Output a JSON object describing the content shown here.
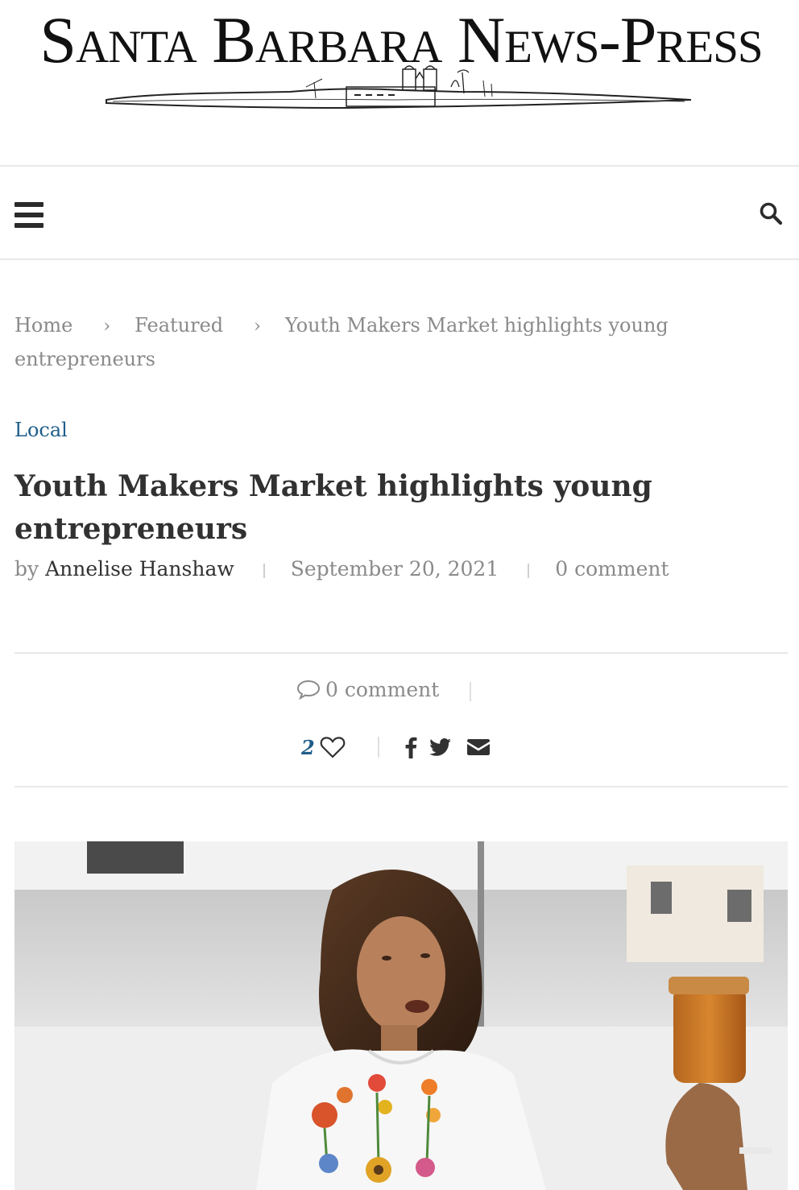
{
  "masthead": {
    "title": "Santa Barbara News-Press"
  },
  "nav": {
    "menu_icon": "hamburger-icon",
    "search_icon": "search-icon"
  },
  "breadcrumb": {
    "home": "Home",
    "featured": "Featured",
    "current": "Youth Makers Market highlights young entrepreneurs",
    "separator": "›"
  },
  "article": {
    "category": "Local",
    "title": "Youth Makers Market highlights young entrepreneurs",
    "by_label": "by",
    "author": "Annelise Hanshaw",
    "date": "September 20, 2021",
    "comments": "0 comment"
  },
  "share": {
    "comment_label": "0 comment",
    "like_count": "2",
    "icons": [
      "comment-icon",
      "heart-icon",
      "facebook-icon",
      "twitter-icon",
      "email-icon"
    ]
  },
  "colors": {
    "accent": "#1f5e8a",
    "text": "#313131",
    "muted": "#8a8a8a",
    "rule": "#e8e8e8"
  }
}
